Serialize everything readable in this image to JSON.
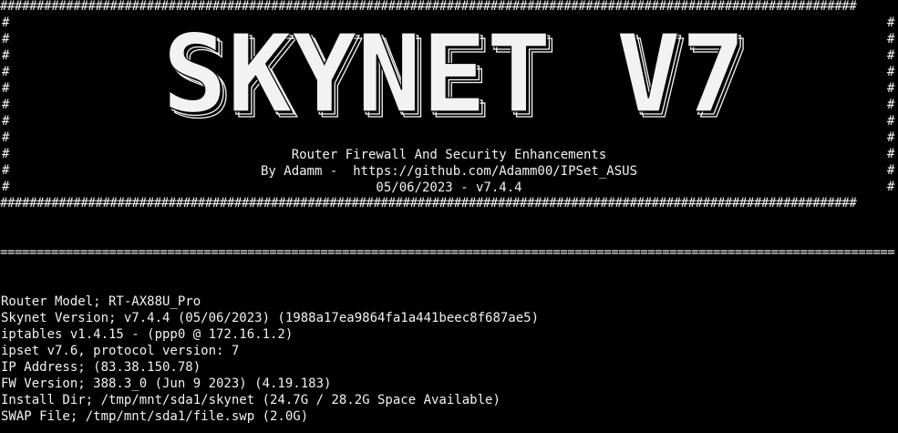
{
  "terminal": {
    "colors": {
      "background": "#000000",
      "text": "#f2f2f2"
    },
    "border_char": "#",
    "border_top": "#####################################################################################################################",
    "border_bottom": "#####################################################################################################################",
    "banner": {
      "logo_text": "SKYNET V7",
      "subtitle": "Router Firewall And Security Enhancements",
      "author_line": "By Adamm -  https://github.com/Adamm00/IPSet_ASUS",
      "date_line": "05/06/2023 - v7.4.4"
    },
    "separator": "===========================================================================================================================",
    "info": [
      "Router Model; RT-AX88U_Pro",
      "Skynet Version; v7.4.4 (05/06/2023) (1988a17ea9864fa1a441beec8f687ae5)",
      "iptables v1.4.15 - (ppp0 @ 172.16.1.2)",
      "ipset v7.6, protocol version: 7",
      "IP Address; (83.38.150.78)",
      "FW Version; 388.3_0 (Jun 9 2023) (4.19.183)",
      "Install Dir; /tmp/mnt/sda1/skynet (24.7G / 28.2G Space Available)",
      "SWAP File; /tmp/mnt/sda1/file.swp (2.0G)"
    ]
  }
}
